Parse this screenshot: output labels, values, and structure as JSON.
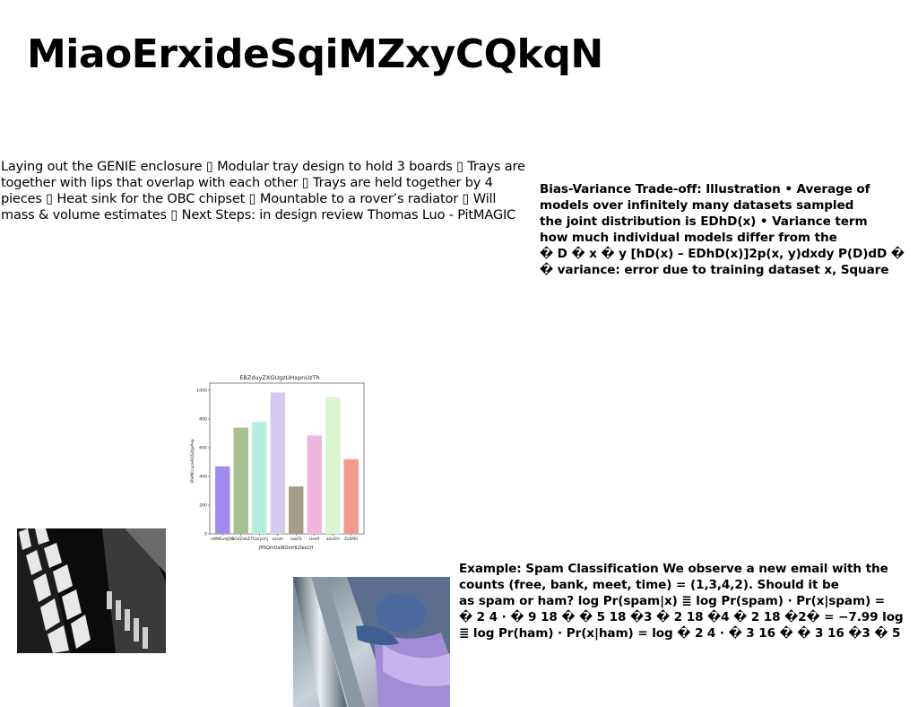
{
  "title": "MiaoErxideSqiMZxyCQkqN",
  "para_left": "Laying out the GENIE enclosure ▯ Modular tray design to hold 3 boards ▯ Trays are together with lips that overlap with each other ▯ Trays are held together by 4 pieces ▯ Heat sink for the OBC chipset ▯ Mountable to a rover’s radiator ▯ Will mass & volume estimates ▯ Next Steps: in design review Thomas Luo - PitMAGIC",
  "para_right": {
    "lines": [
      "Bias-Variance Trade-off: Illustration • Average of",
      "models over infinitely many datasets sampled",
      "the joint distribution is EDhD(x) • Variance term",
      "how much individual models differ from the",
      "� D � x � y [hD(x) – EDhD(x)]2p(x, y)dxdy P(D)dD �",
      "� variance: error due to training dataset x, Square"
    ]
  },
  "para_spam": {
    "lines": [
      "Example: Spam Classification We observe a new email with the",
      "counts (free, bank, meet, time) = (1,3,4,2). Should it be",
      "as spam or ham? log Pr(spam|x) ≣ log Pr(spam) · Pr(x|spam) =",
      "� 2 4 · � 9 18 � � 5 18 �3 � 2 18 �4 � 2 18 �2� = −7.99 log",
      "≣ log Pr(ham) · Pr(x|ham) = log � 2 4 · � 3 16 � � 3 16 �3 � 5"
    ]
  },
  "chart_data": {
    "type": "bar",
    "title": "EBZduyZXGUgzUHxpnUzTh",
    "xlabel": "JffSQmUaWOmHLDexLH",
    "ylabel": "IPaMCcuzsAQGXJpPep",
    "categories": [
      "eWWLmJQG",
      "bGdZnbZ",
      "TGarjzmj",
      "xssxh",
      "iawFS",
      "Uedif",
      "advGH",
      "ZsXMG"
    ],
    "values": [
      470,
      740,
      780,
      985,
      330,
      685,
      955,
      520
    ],
    "colors": [
      "#9f8bf0",
      "#a9bf8f",
      "#b5f0da",
      "#d5c9f0",
      "#a39f8a",
      "#efb5df",
      "#dbf5cf",
      "#f3998f"
    ],
    "ylim": [
      0,
      1050
    ],
    "yticks": [
      0,
      200,
      400,
      600,
      800,
      1000
    ],
    "grid": false
  },
  "images": {
    "building_photo": "black-and-white-building-photo",
    "figure_photo": "purple-figure-photo"
  }
}
